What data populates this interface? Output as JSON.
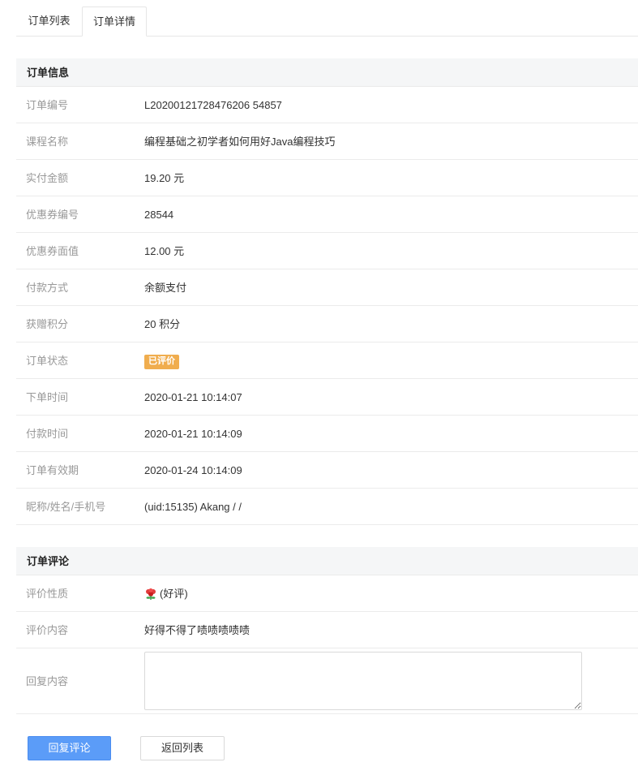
{
  "tabs": {
    "list_label": "订单列表",
    "detail_label": "订单详情"
  },
  "order_info": {
    "heading": "订单信息",
    "rows": [
      {
        "label": "订单编号",
        "value": "L20200121728476206 54857"
      },
      {
        "label": "课程名称",
        "value": "编程基础之初学者如何用好Java编程技巧"
      },
      {
        "label": "实付金额",
        "value": "19.20 元"
      },
      {
        "label": "优惠券编号",
        "value": "28544"
      },
      {
        "label": "优惠券面值",
        "value": "12.00 元"
      },
      {
        "label": "付款方式",
        "value": "余额支付"
      },
      {
        "label": "获赠积分",
        "value": "20 积分"
      },
      {
        "label": "订单状态",
        "value": "已评价"
      },
      {
        "label": "下单时间",
        "value": "2020-01-21 10:14:07"
      },
      {
        "label": "付款时间",
        "value": "2020-01-21 10:14:09"
      },
      {
        "label": "订单有效期",
        "value": "2020-01-24 10:14:09"
      },
      {
        "label": "昵称/姓名/手机号",
        "value": "(uid:15135) Akang /  /"
      }
    ]
  },
  "order_review": {
    "heading": "订单评论",
    "nature_label": "评价性质",
    "nature_value": "(好评)",
    "content_label": "评价内容",
    "content_value": "好得不得了啧啧啧啧啧",
    "reply_label": "回复内容",
    "reply_value": ""
  },
  "buttons": {
    "reply": "回复评论",
    "back": "返回列表"
  },
  "colors": {
    "badge": "#f0ad4e",
    "primary": "#5b9cf8",
    "section_bg": "#f5f6f7"
  },
  "icons": {
    "nature": "flower-icon"
  }
}
